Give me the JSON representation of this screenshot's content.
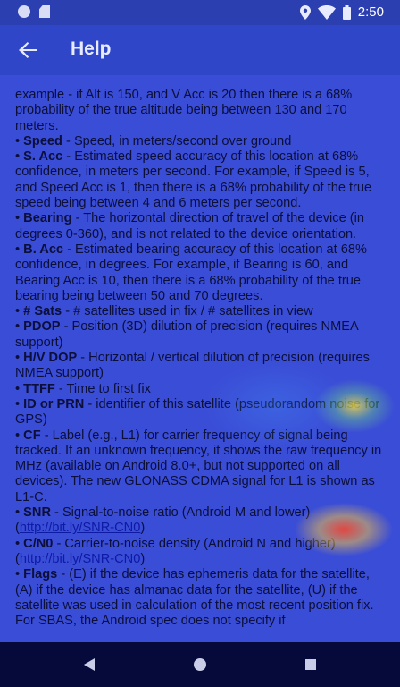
{
  "status": {
    "time": "2:50"
  },
  "appbar": {
    "title": "Help"
  },
  "help": {
    "intro": "example - if Alt is 150, and V Acc is 20 then there is a 68% probability of the true altitude being between 130 and 170 meters.",
    "items": [
      {
        "term": "Speed",
        "desc": " - Speed, in meters/second over ground"
      },
      {
        "term": "S. Acc",
        "desc": " - Estimated speed accuracy of this location at 68% confidence, in meters per second. For example, if Speed is 5, and Speed Acc is 1, then there is a 68% probability of the true speed being between 4 and 6 meters per second."
      },
      {
        "term": "Bearing",
        "desc": " - The horizontal direction of travel of the device (in degrees 0-360), and is not related to the device orientation."
      },
      {
        "term": "B. Acc",
        "desc": " - Estimated bearing accuracy of this location at 68% confidence, in degrees. For example, if Bearing is 60, and Bearing Acc is 10, then there is a 68% probability of the true bearing being between 50 and 70 degrees."
      },
      {
        "term": "# Sats",
        "desc": " - # satellites used in fix / # satellites in view"
      },
      {
        "term": "PDOP",
        "desc": " - Position (3D) dilution of precision (requires NMEA support)"
      },
      {
        "term": "H/V DOP",
        "desc": " - Horizontal / vertical dilution of precision (requires NMEA support)"
      },
      {
        "term": "TTFF",
        "desc": " - Time to first fix"
      },
      {
        "term": "ID or PRN",
        "desc": " - identifier of this satellite (pseudorandom noise for GPS)"
      },
      {
        "term": "CF",
        "desc": " - Label (e.g., L1) for carrier frequency of signal being tracked. If an unknown frequency, it shows the raw frequency in MHz (available on Android 8.0+, but not supported on all devices). The new GLONASS CDMA signal for L1 is shown as L1-C."
      },
      {
        "term": "SNR",
        "desc": " - Signal-to-noise ratio (Android M and lower)",
        "link": "http://bit.ly/SNR-CN0"
      },
      {
        "term": "C/N0",
        "desc": " - Carrier-to-noise density (Android N and higher)",
        "link": "http://bit.ly/SNR-CN0"
      },
      {
        "term": "Flags",
        "desc": " - (E) if the device has ephemeris data for the satellite, (A) if the device has almanac data for the satellite, (U) if the satellite was used in calculation of the most recent position fix. For SBAS, the Android spec does not specify if"
      }
    ]
  },
  "icons": {
    "status_left": [
      "circle-notification-icon",
      "sd-card-icon"
    ],
    "status_right": [
      "location-icon",
      "wifi-icon",
      "battery-icon"
    ],
    "nav": [
      "back-triangle-icon",
      "home-circle-icon",
      "recents-square-icon"
    ]
  }
}
